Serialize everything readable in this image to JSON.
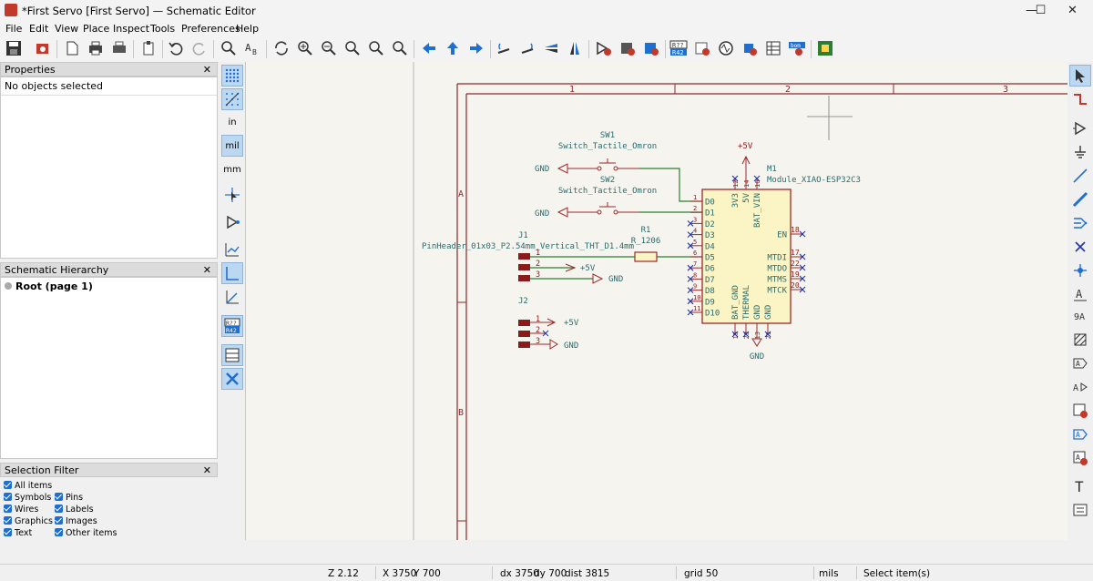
{
  "window": {
    "title": "*First Servo [First Servo] — Schematic Editor",
    "controls": {
      "minimize": "—",
      "maximize": "☐",
      "close": "✕"
    }
  },
  "menu": [
    "File",
    "Edit",
    "View",
    "Place",
    "Inspect",
    "Tools",
    "Preferences",
    "Help"
  ],
  "properties_panel": {
    "title": "Properties",
    "close": "✕",
    "status": "No objects selected"
  },
  "hierarchy_panel": {
    "title": "Schematic Hierarchy",
    "close": "✕",
    "root": "Root (page 1)"
  },
  "selection_filter": {
    "title": "Selection Filter",
    "close": "✕",
    "items": [
      "All items",
      "Symbols",
      "Pins",
      "Wires",
      "Labels",
      "Graphics",
      "Images",
      "Text",
      "Other items"
    ]
  },
  "left_toolbar": {
    "units_in": "in",
    "units_mil": "mil",
    "units_mm": "mm"
  },
  "status": {
    "zoom": "Z 2.12",
    "x": "X 3750",
    "y": "Y 700",
    "dx": "dx 3750",
    "dy": "dy 700",
    "dist": "dist 3815",
    "grid": "grid 50",
    "units": "mils",
    "mode": "Select item(s)"
  },
  "schematic": {
    "border_cols": [
      "1",
      "2",
      "3"
    ],
    "border_rows": [
      "A",
      "B"
    ],
    "sw1": {
      "ref": "SW1",
      "value": "Switch_Tactile_Omron",
      "gnd": "GND"
    },
    "sw2": {
      "ref": "SW2",
      "value": "Switch_Tactile_Omron",
      "gnd": "GND"
    },
    "r1": {
      "ref": "R1",
      "value": "R_1206"
    },
    "j1": {
      "ref": "J1",
      "value": "PinHeader_01x03_P2.54mm_Vertical_THT_D1.4mm",
      "pins": [
        "1",
        "2",
        "3"
      ],
      "p5v": "+5V",
      "gnd": "GND"
    },
    "j2": {
      "ref": "J2",
      "pins": [
        "1",
        "2",
        "3"
      ],
      "p5v": "+5V",
      "gnd": "GND"
    },
    "m1": {
      "ref": "M1",
      "value": "Module_XIAO-ESP32C3",
      "power": "+5V",
      "gnd": "GND",
      "left_pins": [
        {
          "num": "1",
          "name": "D0"
        },
        {
          "num": "2",
          "name": "D1"
        },
        {
          "num": "3",
          "name": "D2"
        },
        {
          "num": "4",
          "name": "D3"
        },
        {
          "num": "5",
          "name": "D4"
        },
        {
          "num": "6",
          "name": "D5"
        },
        {
          "num": "7",
          "name": "D6"
        },
        {
          "num": "8",
          "name": "D7"
        },
        {
          "num": "9",
          "name": "D8"
        },
        {
          "num": "10",
          "name": "D9"
        },
        {
          "num": "11",
          "name": "D10"
        }
      ],
      "right_pins": [
        {
          "num": "18",
          "name": "EN"
        },
        {
          "num": "17",
          "name": "MTDI"
        },
        {
          "num": "22",
          "name": "MTDO"
        },
        {
          "num": "19",
          "name": "MTMS"
        },
        {
          "num": "20",
          "name": "MTCK"
        }
      ],
      "top_pins": [
        {
          "num": "12",
          "name": "3V3"
        },
        {
          "num": "14",
          "name": "5V"
        },
        {
          "num": "16",
          "name": "BAT_VIN"
        }
      ],
      "bottom_pins": [
        {
          "num": "15",
          "name": "BAT_GND"
        },
        {
          "num": "23",
          "name": "THERMAL"
        },
        {
          "num": "13",
          "name": "GND"
        },
        {
          "num": "21",
          "name": "GND"
        }
      ]
    }
  },
  "colors": {
    "canvas_bg": "#f5f4ef",
    "sheet_border": "#8b2a2a",
    "wire": "#2f7d2f",
    "symbol_outline": "#9c2a2a",
    "symbol_fill": "#fbf4c5",
    "text": "#2b6b6b",
    "power": "#8b1a1a",
    "no_connect": "#2233aa"
  }
}
